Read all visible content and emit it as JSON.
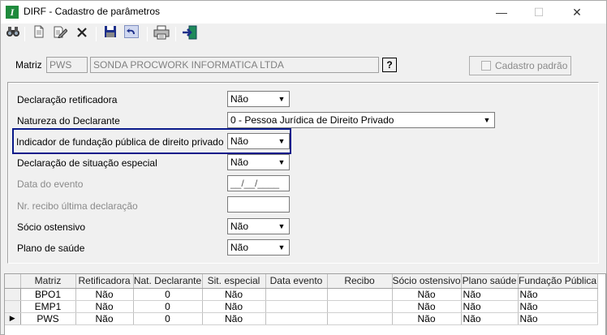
{
  "window": {
    "title": "DIRF - Cadastro de parâmetros",
    "app_icon_glyph": "I",
    "minimize": "—",
    "maximize": "☐",
    "close": "✕"
  },
  "toolbar": {
    "icons": [
      "binoculars-icon",
      "new-document-icon",
      "edit-icon",
      "delete-icon",
      "save-icon",
      "undo-icon",
      "print-icon",
      "exit-icon"
    ]
  },
  "matriz": {
    "label": "Matriz",
    "code": "PWS",
    "name": "SONDA PROCWORK INFORMATICA LTDA",
    "help": "?",
    "cadastro_padrao": "Cadastro padrão"
  },
  "form": {
    "declaracao_retificadora": {
      "label": "Declaração retificadora",
      "value": "Não"
    },
    "natureza_declarante": {
      "label": "Natureza do Declarante",
      "value": "0 - Pessoa Jurídica de Direito Privado"
    },
    "indicador_fundacao": {
      "label": "Indicador de fundação pública de direito privado",
      "value": "Não"
    },
    "declaracao_situacao": {
      "label": "Declaração de situação especial",
      "value": "Não"
    },
    "data_evento": {
      "label": "Data do evento",
      "value": "__/__/____"
    },
    "nr_recibo": {
      "label": "Nr. recibo última declaração",
      "value": ""
    },
    "socio_ostensivo": {
      "label": "Sócio ostensivo",
      "value": "Não"
    },
    "plano_saude": {
      "label": "Plano de saúde",
      "value": "Não"
    }
  },
  "grid": {
    "columns": [
      "Matriz",
      "Retificadora",
      "Nat. Declarante",
      "Sit. especial",
      "Data evento",
      "Recibo",
      "Sócio ostensivo",
      "Plano saúde",
      "Fundação Pública"
    ],
    "rows": [
      [
        "BPO1",
        "Não",
        "0",
        "Não",
        "",
        "",
        "Não",
        "Não",
        "Não"
      ],
      [
        "EMP1",
        "Não",
        "0",
        "Não",
        "",
        "",
        "Não",
        "Não",
        "Não"
      ],
      [
        "PWS",
        "Não",
        "0",
        "Não",
        "",
        "",
        "Não",
        "Não",
        "Não"
      ]
    ],
    "current_row_marker": "▶"
  }
}
